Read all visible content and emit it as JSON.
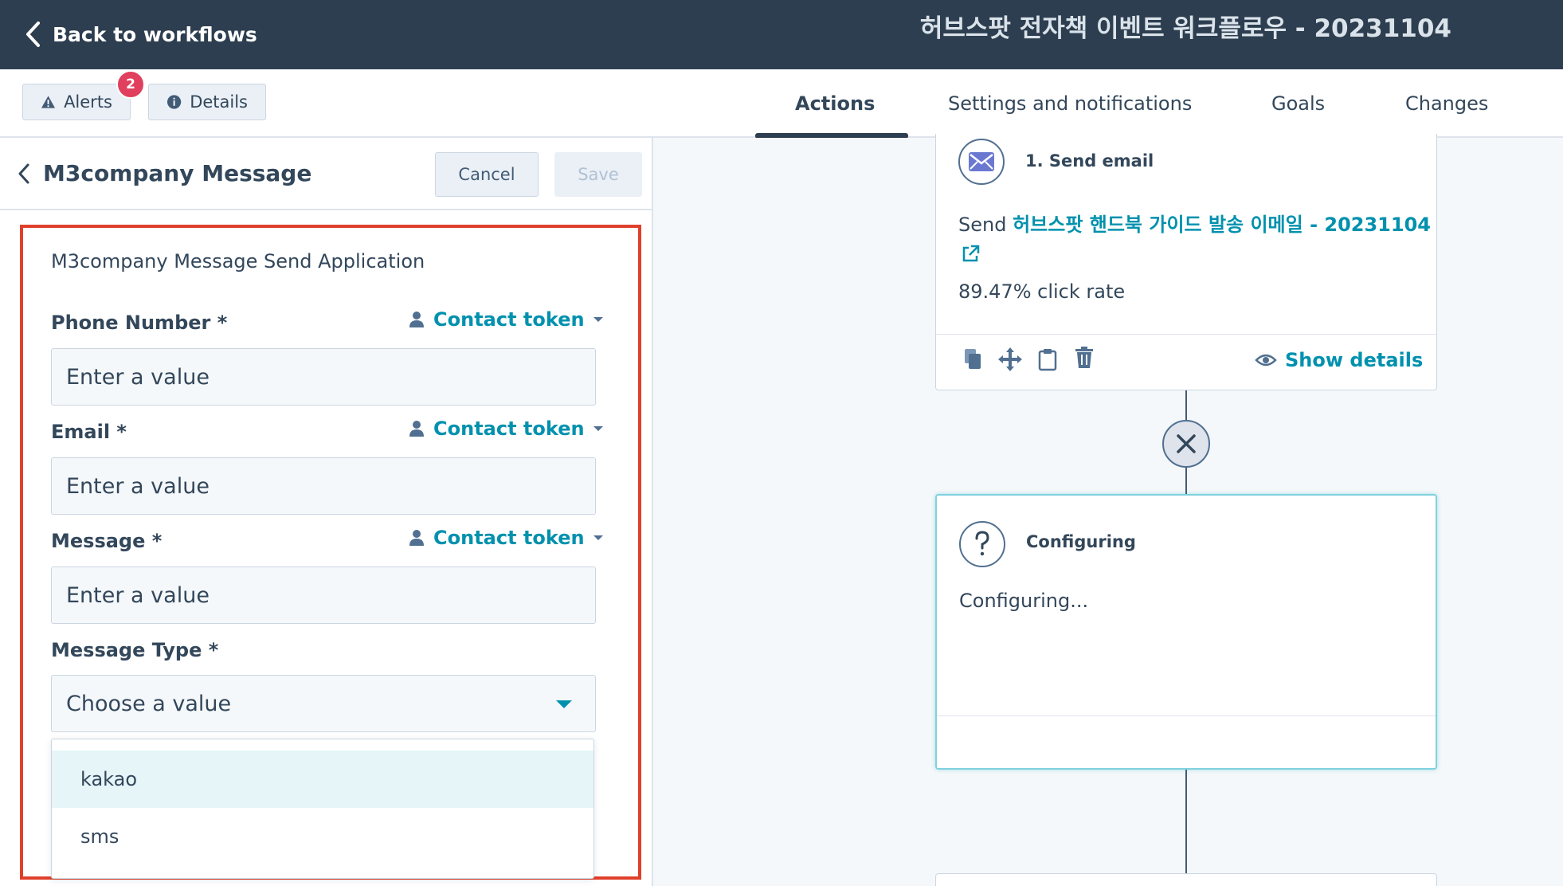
{
  "topbar": {
    "back_label": "Back to workflows",
    "workflow_title": "허브스팟 전자책 이벤트 워크플로우 - 20231104"
  },
  "subbar": {
    "alerts_label": "Alerts",
    "alerts_count": "2",
    "details_label": "Details",
    "tabs": [
      {
        "label": "Actions",
        "active": true
      },
      {
        "label": "Settings and notifications",
        "active": false
      },
      {
        "label": "Goals",
        "active": false
      },
      {
        "label": "Changes",
        "active": false
      }
    ]
  },
  "panel": {
    "title": "M3company Message",
    "cancel_label": "Cancel",
    "save_label": "Save",
    "section_label": "M3company Message Send Application",
    "token_label": "Contact token",
    "fields": [
      {
        "label": "Phone Number *",
        "placeholder": "Enter a value"
      },
      {
        "label": "Email *",
        "placeholder": "Enter a value"
      },
      {
        "label": "Message *",
        "placeholder": "Enter a value"
      }
    ],
    "message_type": {
      "label": "Message Type *",
      "value": "Choose a value",
      "options": [
        "kakao",
        "sms"
      ]
    }
  },
  "canvas": {
    "send_email": {
      "title": "1. Send email",
      "send_prefix": "Send",
      "email_name": "허브스팟 핸드북 가이드 발송 이메일 - 20231104",
      "click_rate": "89.47% click rate",
      "show_details": "Show details"
    },
    "configuring": {
      "title": "Configuring",
      "body": "Configuring..."
    }
  },
  "colors": {
    "topbar": "#2d3e50",
    "link": "#0091ae",
    "highlight": "#e0402b",
    "badge": "#e0405d"
  }
}
